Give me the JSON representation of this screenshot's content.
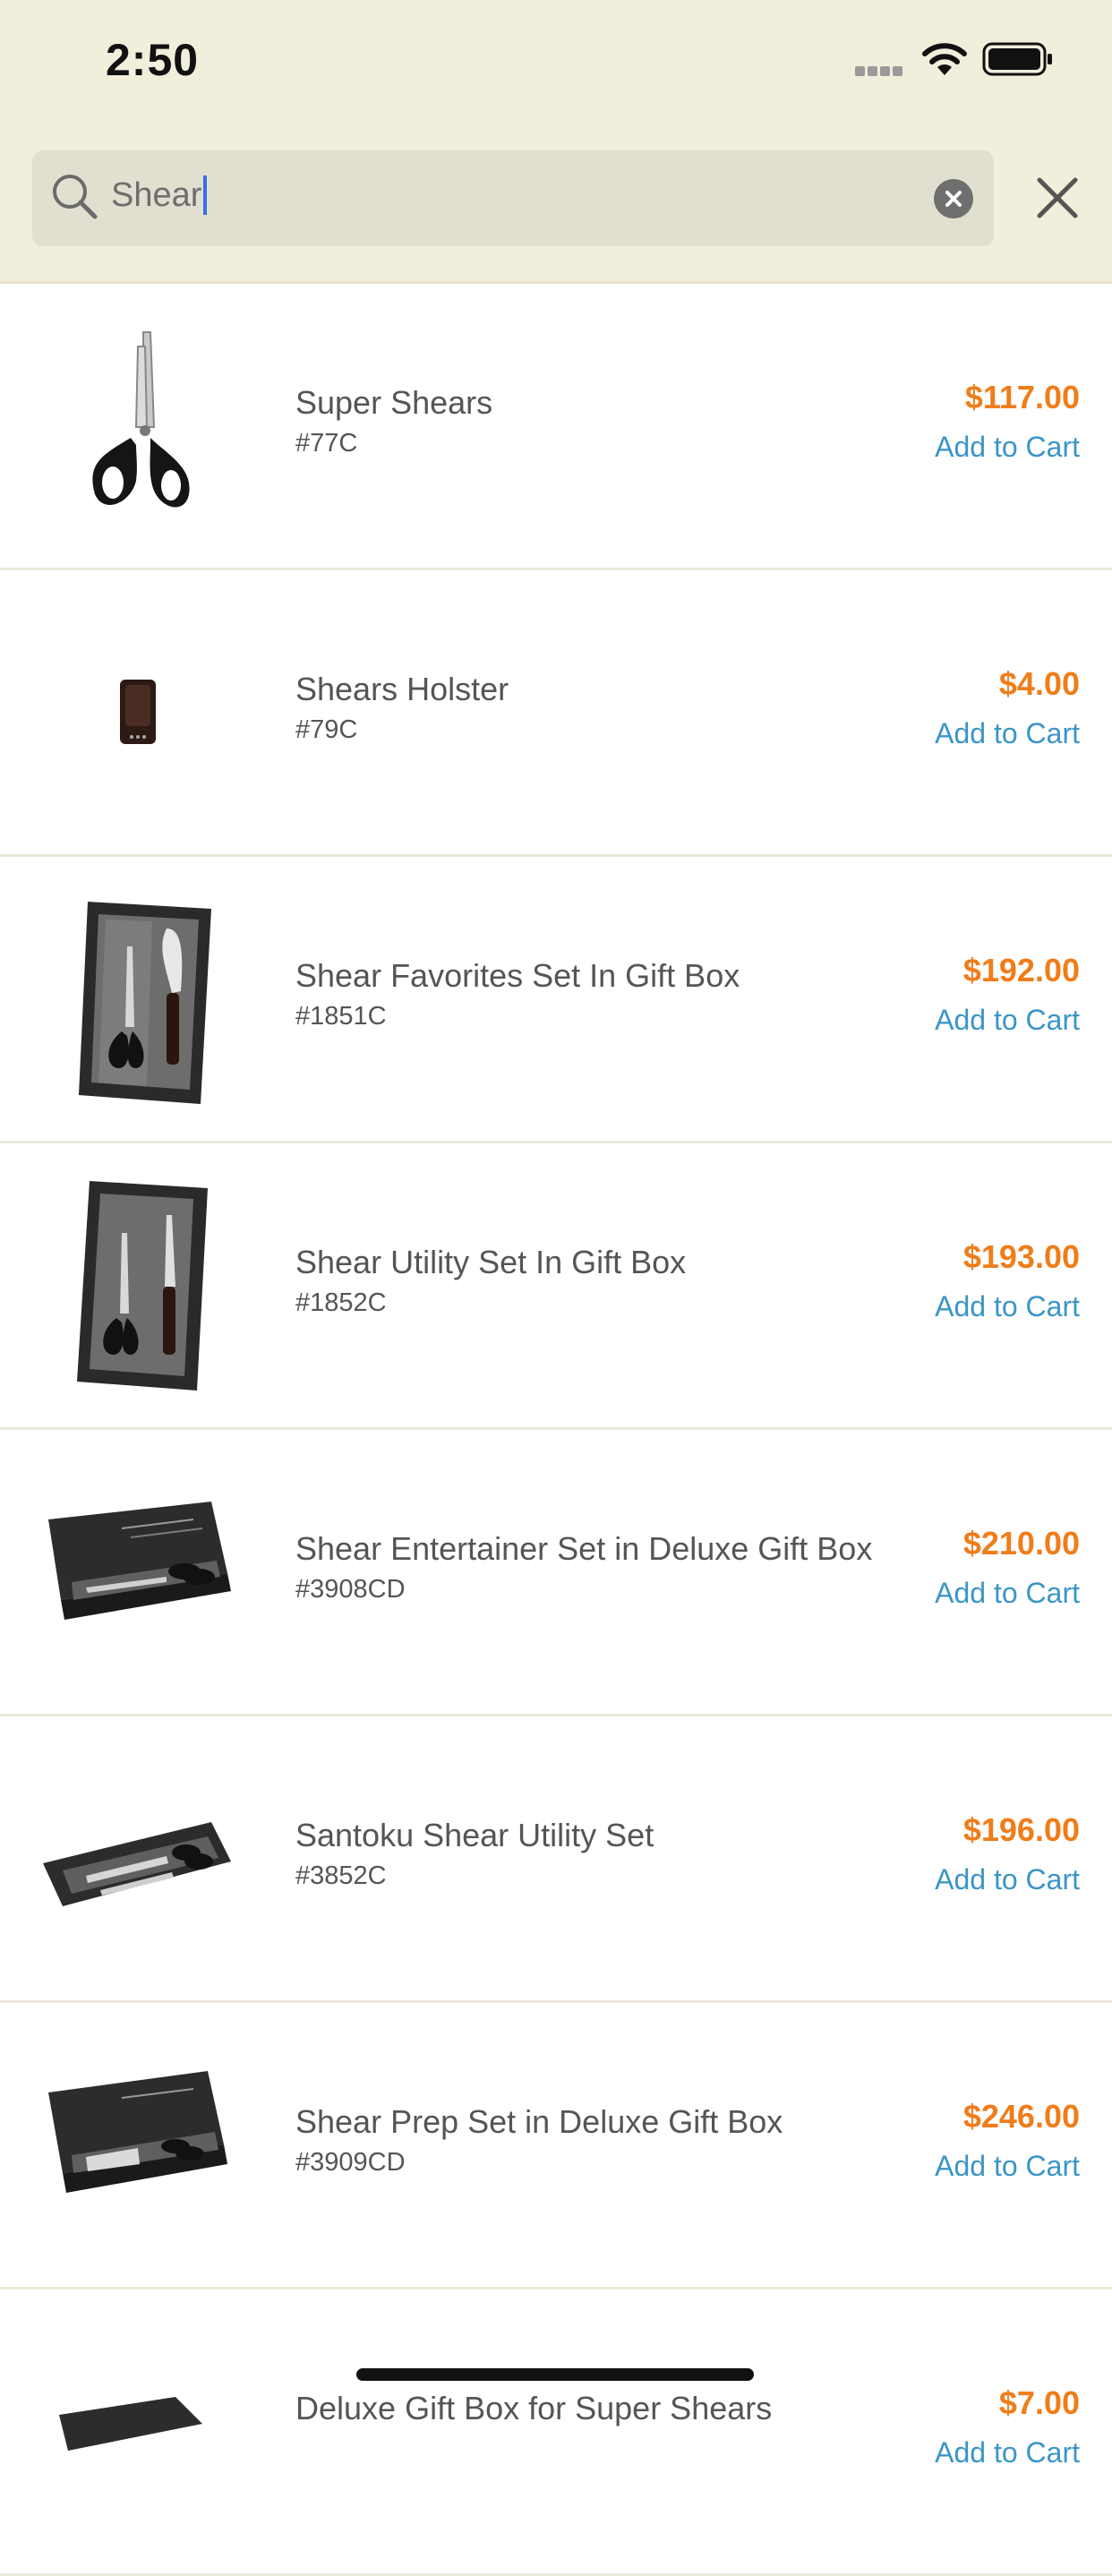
{
  "status_bar": {
    "time": "2:50"
  },
  "search": {
    "value": "Shear"
  },
  "products": [
    {
      "name": "Super Shears",
      "sku": "#77C",
      "price": "$117.00",
      "cart_label": "Add to Cart",
      "image": "scissors"
    },
    {
      "name": "Shears Holster",
      "sku": "#79C",
      "price": "$4.00",
      "cart_label": "Add to Cart",
      "image": "holster"
    },
    {
      "name": "Shear Favorites Set In Gift Box",
      "sku": "#1851C",
      "price": "$192.00",
      "cart_label": "Add to Cart",
      "image": "tall-gift-box"
    },
    {
      "name": "Shear Utility Set In Gift Box",
      "sku": "#1852C",
      "price": "$193.00",
      "cart_label": "Add to Cart",
      "image": "tall-gift-box"
    },
    {
      "name": "Shear Entertainer Set in Deluxe Gift Box",
      "sku": "#3908CD",
      "price": "$210.00",
      "cart_label": "Add to Cart",
      "image": "deluxe-gift-box"
    },
    {
      "name": "Santoku Shear Utility Set",
      "sku": "#3852C",
      "price": "$196.00",
      "cart_label": "Add to Cart",
      "image": "open-box-set"
    },
    {
      "name": "Shear Prep Set in Deluxe Gift Box",
      "sku": "#3909CD",
      "price": "$246.00",
      "cart_label": "Add to Cart",
      "image": "deluxe-gift-box"
    },
    {
      "name": "Deluxe Gift Box for Super Shears",
      "sku": "",
      "price": "$7.00",
      "cart_label": "Add to Cart",
      "image": "deluxe-gift-box"
    }
  ],
  "colors": {
    "price": "#ef7d1a",
    "link": "#3b95c8",
    "header_bg": "#f1eedc"
  }
}
